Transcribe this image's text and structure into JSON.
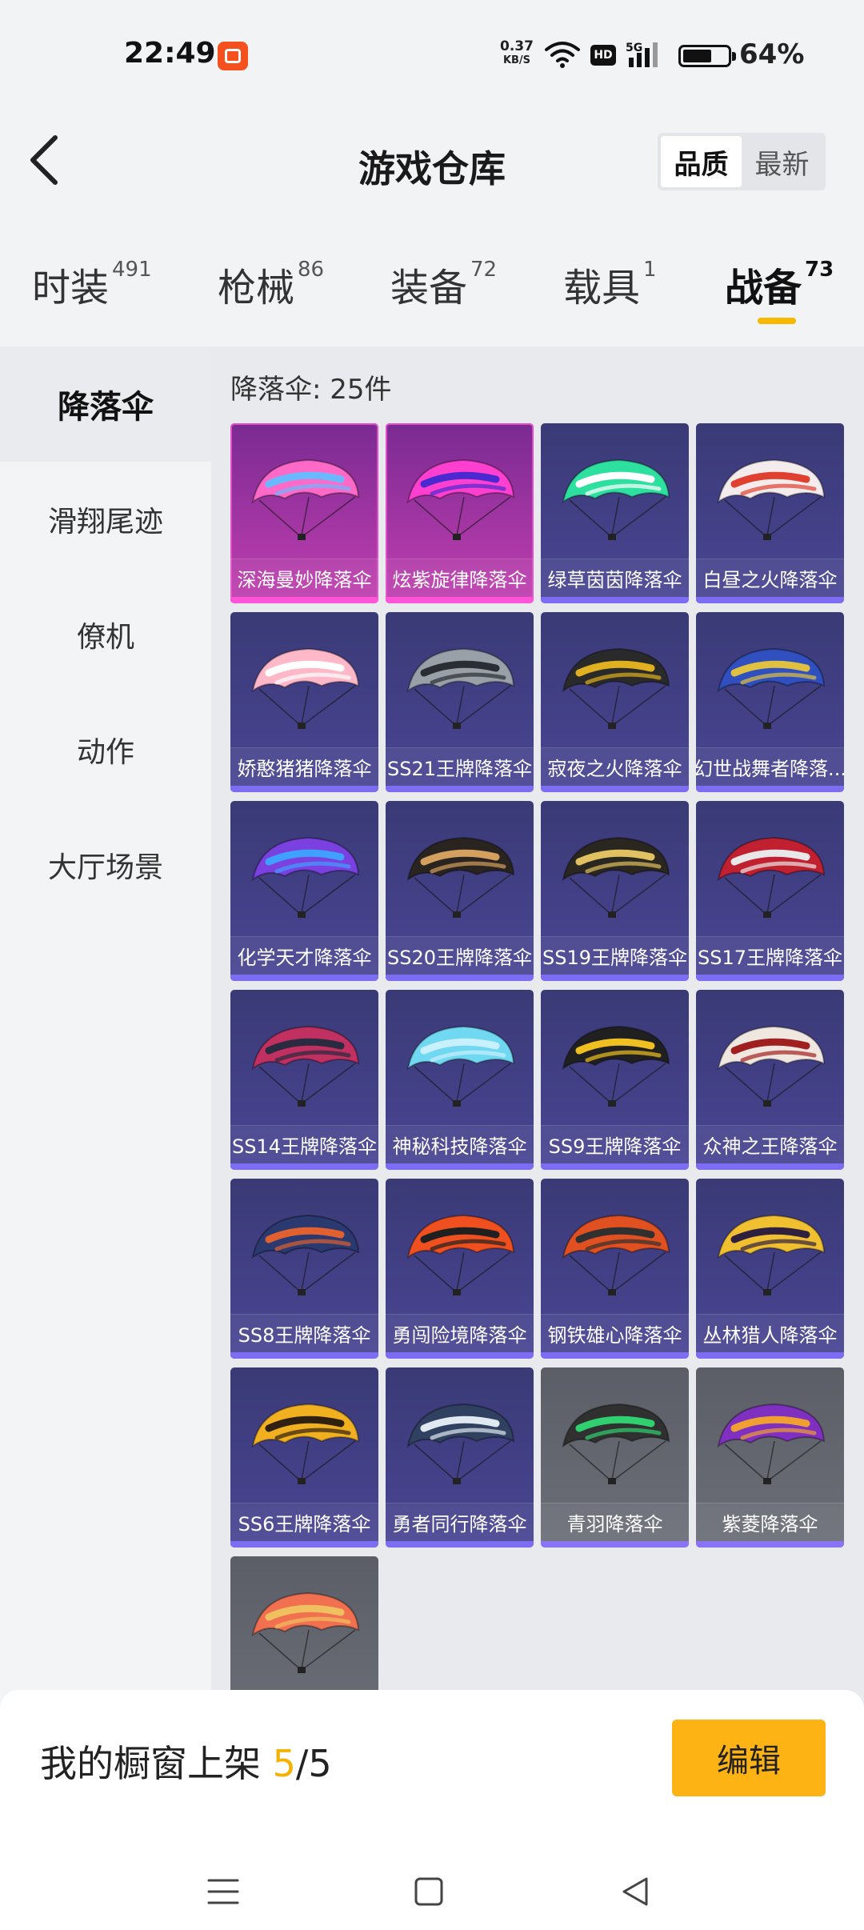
{
  "status_bar": {
    "time": "22:49",
    "net_speed": "0.37",
    "net_unit": "KB/S",
    "hd": "HD",
    "network": "5G",
    "battery_percent": "64%",
    "battery_level": 0.64
  },
  "header": {
    "title": "游戏仓库",
    "sort_options": [
      "品质",
      "最新"
    ],
    "sort_active": 0
  },
  "tabs": [
    {
      "label": "时装",
      "count": "491"
    },
    {
      "label": "枪械",
      "count": "86"
    },
    {
      "label": "装备",
      "count": "72"
    },
    {
      "label": "载具",
      "count": "1"
    },
    {
      "label": "战备",
      "count": "73",
      "active": true
    }
  ],
  "sidebar": {
    "items": [
      "降落伞",
      "滑翔尾迹",
      "僚机",
      "动作",
      "大厅场景"
    ],
    "active": 0
  },
  "grid": {
    "count_label": "降落伞: 25件",
    "items": [
      {
        "label": "深海曼妙降落伞",
        "rarity": "pink",
        "colors": [
          "#ff6ac8",
          "#6ab8ff"
        ]
      },
      {
        "label": "炫紫旋律降落伞",
        "rarity": "pink",
        "colors": [
          "#ff3fd0",
          "#4a2ad0"
        ]
      },
      {
        "label": "绿草茵茵降落伞",
        "rarity": "purple",
        "colors": [
          "#2ee0a0",
          "#ffffff"
        ]
      },
      {
        "label": "白昼之火降落伞",
        "rarity": "purple",
        "colors": [
          "#f4ecec",
          "#e04030"
        ]
      },
      {
        "label": "娇憨猪猪降落伞",
        "rarity": "purple",
        "colors": [
          "#ffb8c8",
          "#ffffff"
        ]
      },
      {
        "label": "SS21王牌降落伞",
        "rarity": "purple",
        "colors": [
          "#9aa0a8",
          "#2a2e34"
        ]
      },
      {
        "label": "寂夜之火降落伞",
        "rarity": "purple",
        "colors": [
          "#2a2a2a",
          "#e0b020"
        ]
      },
      {
        "label": "幻世战舞者降落...",
        "rarity": "purple",
        "colors": [
          "#3050c0",
          "#e0c040"
        ]
      },
      {
        "label": "化学天才降落伞",
        "rarity": "purple",
        "colors": [
          "#7a40e0",
          "#40a0ff"
        ]
      },
      {
        "label": "SS20王牌降落伞",
        "rarity": "purple",
        "colors": [
          "#2a2420",
          "#d4a060"
        ]
      },
      {
        "label": "SS19王牌降落伞",
        "rarity": "purple",
        "colors": [
          "#2a2620",
          "#e0c060"
        ]
      },
      {
        "label": "SS17王牌降落伞",
        "rarity": "purple",
        "colors": [
          "#c02030",
          "#e8e8e8"
        ]
      },
      {
        "label": "SS14王牌降落伞",
        "rarity": "purple",
        "colors": [
          "#c03060",
          "#2a2a40"
        ]
      },
      {
        "label": "神秘科技降落伞",
        "rarity": "purple",
        "colors": [
          "#70d8f0",
          "#c8f0ff"
        ]
      },
      {
        "label": "SS9王牌降落伞",
        "rarity": "purple",
        "colors": [
          "#202020",
          "#f0c020"
        ]
      },
      {
        "label": "众神之王降落伞",
        "rarity": "purple",
        "colors": [
          "#f0e8e0",
          "#a02020"
        ]
      },
      {
        "label": "SS8王牌降落伞",
        "rarity": "purple",
        "colors": [
          "#2a3a70",
          "#e06030"
        ]
      },
      {
        "label": "勇闯险境降落伞",
        "rarity": "purple",
        "colors": [
          "#f05020",
          "#202020"
        ]
      },
      {
        "label": "钢铁雄心降落伞",
        "rarity": "purple",
        "colors": [
          "#e05020",
          "#303030"
        ]
      },
      {
        "label": "丛林猎人降落伞",
        "rarity": "purple",
        "colors": [
          "#f0c030",
          "#302040"
        ]
      },
      {
        "label": "SS6王牌降落伞",
        "rarity": "purple",
        "colors": [
          "#f0b020",
          "#302010"
        ]
      },
      {
        "label": "勇者同行降落伞",
        "rarity": "purple",
        "colors": [
          "#304060",
          "#e0e8f0"
        ]
      },
      {
        "label": "青羽降落伞",
        "rarity": "grey",
        "colors": [
          "#303030",
          "#30d070"
        ]
      },
      {
        "label": "紫菱降落伞",
        "rarity": "grey",
        "colors": [
          "#8030c0",
          "#f0a030"
        ]
      },
      {
        "label": "",
        "rarity": "grey",
        "colors": [
          "#f07050",
          "#f0c060"
        ]
      }
    ]
  },
  "bottom": {
    "showcase_prefix": "我的橱窗上架 ",
    "showcase_current": "5",
    "showcase_sep": "/",
    "showcase_total": "5",
    "edit_label": "编辑"
  },
  "nav": {
    "icons": [
      "menu-icon",
      "home-icon",
      "back-icon"
    ]
  }
}
